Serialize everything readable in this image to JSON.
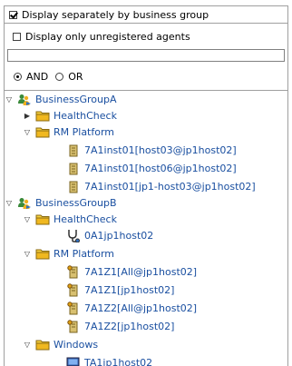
{
  "header": {
    "display_separately_label": "Display separately by business group",
    "display_separately_checked": true
  },
  "filter": {
    "unregistered_label": "Display only unregistered agents",
    "unregistered_checked": false,
    "search_value": "",
    "and_label": "AND",
    "or_label": "OR",
    "selected_operator": "AND"
  },
  "tree": {
    "bg_a": {
      "label": "BusinessGroupA",
      "expanded": true
    },
    "bg_a_healthcheck": {
      "label": "HealthCheck",
      "expanded": false
    },
    "bg_a_rm_platform": {
      "label": "RM Platform",
      "expanded": true
    },
    "bg_a_rm_item_1": {
      "label": "7A1inst01[host03@jp1host02]"
    },
    "bg_a_rm_item_2": {
      "label": "7A1inst01[host06@jp1host02]"
    },
    "bg_a_rm_item_3": {
      "label": "7A1inst01[jp1-host03@jp1host02]"
    },
    "bg_b": {
      "label": "BusinessGroupB",
      "expanded": true
    },
    "bg_b_healthcheck": {
      "label": "HealthCheck",
      "expanded": true
    },
    "bg_b_hc_item_1": {
      "label": "0A1jp1host02"
    },
    "bg_b_rm_platform": {
      "label": "RM Platform",
      "expanded": true
    },
    "bg_b_rm_item_1": {
      "label": "7A1Z1[All@jp1host02]"
    },
    "bg_b_rm_item_2": {
      "label": "7A1Z1[jp1host02]"
    },
    "bg_b_rm_item_3": {
      "label": "7A1Z2[All@jp1host02]"
    },
    "bg_b_rm_item_4": {
      "label": "7A1Z2[jp1host02]"
    },
    "bg_b_windows": {
      "label": "Windows",
      "expanded": true
    },
    "bg_b_win_item_1": {
      "label": "TA1jp1host02"
    }
  },
  "colors": {
    "link": "#1a4fa0",
    "folder": "#f0c020",
    "border": "#a0a0a0"
  }
}
